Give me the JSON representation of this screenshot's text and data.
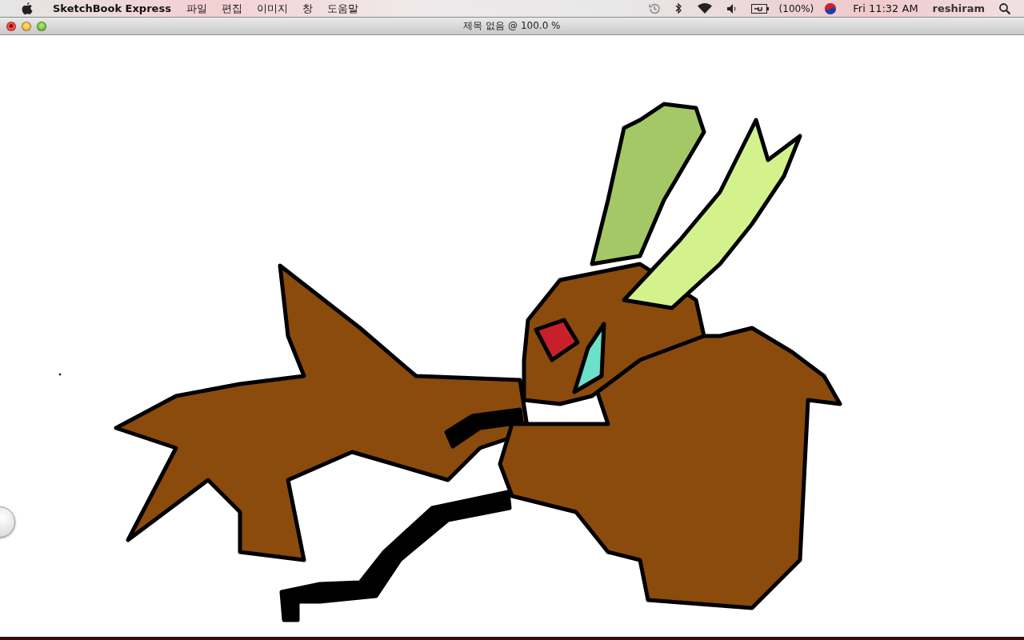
{
  "menu_bar": {
    "app_name": "SketchBook Express",
    "menus": [
      "파일",
      "편집",
      "이미지",
      "창",
      "도움말"
    ],
    "battery": "(100%)",
    "clock": "Fri 11:32 AM",
    "user": "reshiram"
  },
  "window": {
    "title": "제목 없음 @ 100.0 %"
  }
}
